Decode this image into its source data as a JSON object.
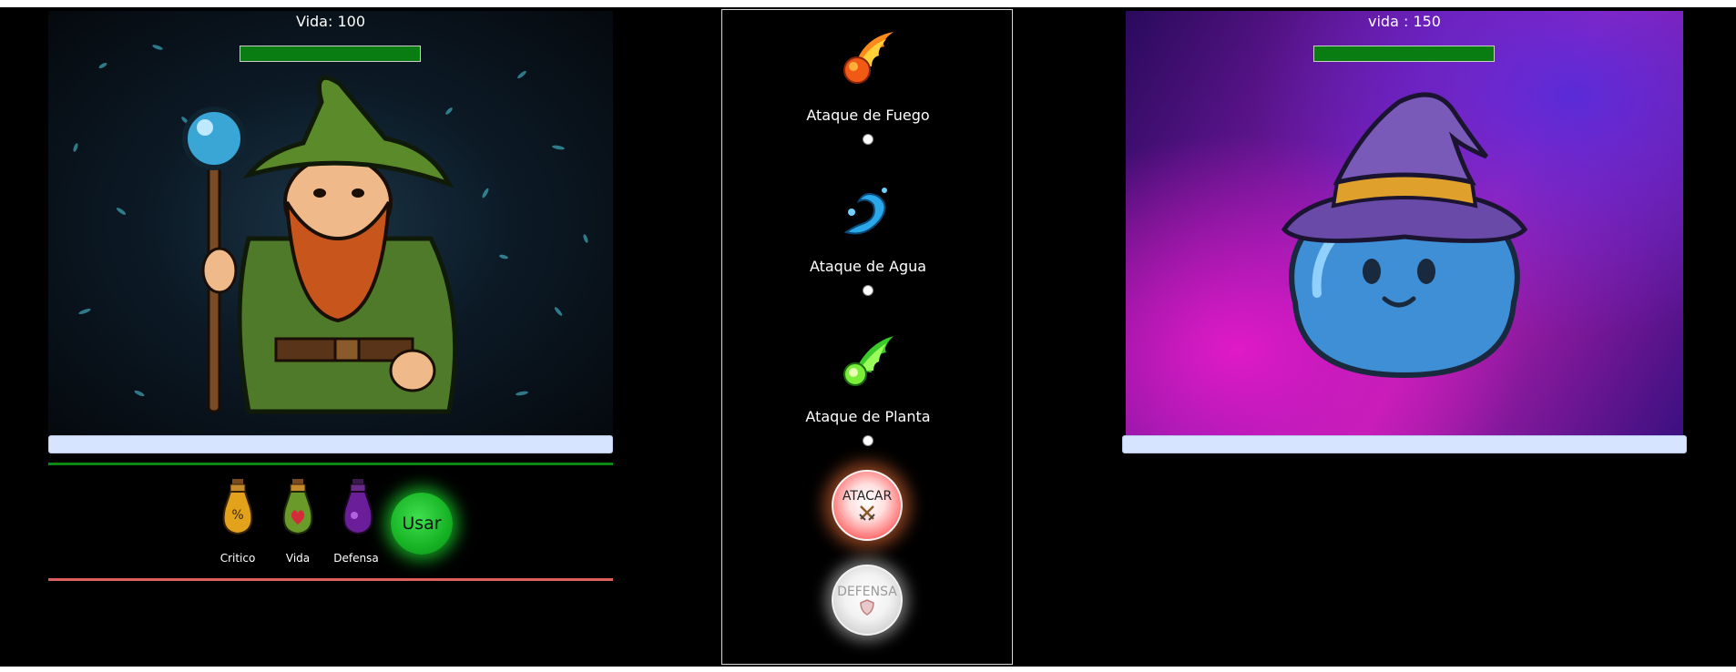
{
  "player": {
    "life_text": "Vida: 100",
    "life_bar_color": "#0a7d12",
    "character_icon": "green-wizard-icon",
    "input_value": ""
  },
  "enemy": {
    "life_text": "vida : 150",
    "life_bar_color": "#0a7d12",
    "character_icon": "blue-slime-wizard-icon",
    "input_value": ""
  },
  "potions": [
    {
      "label": "Critico",
      "icon": "critical-potion-icon"
    },
    {
      "label": "Vida",
      "icon": "life-potion-icon"
    },
    {
      "label": "Defensa",
      "icon": "defense-potion-icon"
    }
  ],
  "use_button_label": "Usar",
  "attacks": [
    {
      "label": "Ataque de Fuego",
      "icon": "fireball-icon"
    },
    {
      "label": "Ataque de Agua",
      "icon": "water-icon"
    },
    {
      "label": "Ataque de Planta",
      "icon": "plant-icon"
    }
  ],
  "attack_button_label": "ATACAR",
  "defense_button_label": "DEFENSA",
  "colors": {
    "background": "#000000",
    "use_button": "#17b325",
    "attack_button": "#ff6a6a",
    "defense_button": "#cfcfcf",
    "separator_green": "#0b8a13",
    "separator_red": "#e06060"
  }
}
